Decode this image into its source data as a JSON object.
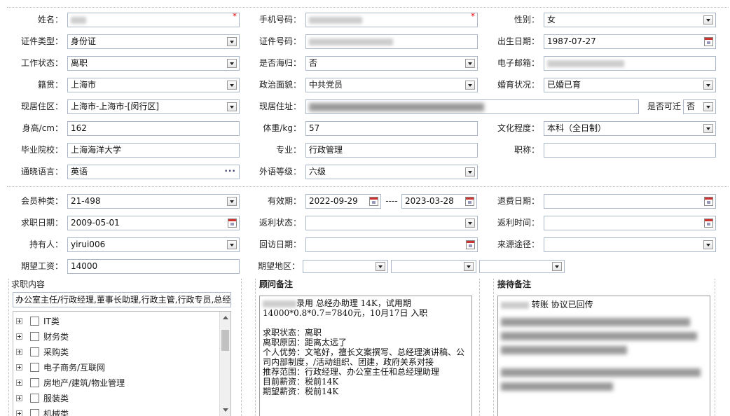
{
  "personal": {
    "name": {
      "label": "姓名：",
      "value": ""
    },
    "phone": {
      "label": "手机号码：",
      "value": ""
    },
    "gender": {
      "label": "性别：",
      "value": "女"
    },
    "id_type": {
      "label": "证件类型：",
      "value": "身份证"
    },
    "id_number": {
      "label": "证件号码：",
      "value": ""
    },
    "birth_date": {
      "label": "出生日期：",
      "value": "1987-07-27"
    },
    "work_status": {
      "label": "工作状态：",
      "value": "离职"
    },
    "returnee": {
      "label": "是否海归：",
      "value": "否"
    },
    "email": {
      "label": "电子邮箱：",
      "value": ""
    },
    "native_place": {
      "label": "籍贯：",
      "value": "上海市"
    },
    "political": {
      "label": "政治面貌：",
      "value": "中共党员"
    },
    "marital": {
      "label": "婚育状况：",
      "value": "已婚已育"
    },
    "current_area": {
      "label": "现居住区：",
      "value": "上海市-上海市-[闵行区]"
    },
    "current_address": {
      "label": "现居住址：",
      "value": ""
    },
    "relocate": {
      "label": "是否可迁",
      "value": "否"
    },
    "height": {
      "label": "身高/cm：",
      "value": "162"
    },
    "weight": {
      "label": "体重/kg：",
      "value": "57"
    },
    "education": {
      "label": "文化程度：",
      "value": "本科（全日制）"
    },
    "school": {
      "label": "毕业院校：",
      "value": "上海海洋大学"
    },
    "major": {
      "label": "专业：",
      "value": "行政管理"
    },
    "title": {
      "label": "职称：",
      "value": ""
    },
    "language": {
      "label": "通晓语言：",
      "value": "英语"
    },
    "language_level": {
      "label": "外语等级：",
      "value": "六级"
    }
  },
  "membership": {
    "member_type": {
      "label": "会员种类：",
      "value": "21-498"
    },
    "validity": {
      "label": "有效期：",
      "start": "2022-09-29",
      "sep": "----",
      "end": "2023-03-28"
    },
    "refund_date": {
      "label": "退费日期：",
      "value": ""
    },
    "job_date": {
      "label": "求职日期：",
      "value": "2009-05-01"
    },
    "rebate_status": {
      "label": "返利状态：",
      "value": ""
    },
    "rebate_time": {
      "label": "返利时间：",
      "value": ""
    },
    "holder": {
      "label": "持有人：",
      "value": "yirui006"
    },
    "visit_date": {
      "label": "回访日期：",
      "value": ""
    },
    "source": {
      "label": "来源途径：",
      "value": ""
    },
    "expected_salary": {
      "label": "期望工资：",
      "value": "14000"
    },
    "expected_area": {
      "label": "期望地区：",
      "v1": "",
      "v2": "",
      "v3": ""
    }
  },
  "job_content": {
    "title": "求职内容",
    "value": "办公室主任/行政经理,董事长助理,行政主管,行政专员,总经",
    "categories": [
      "IT类",
      "财务类",
      "采购类",
      "电子商务/互联网",
      "房地产/建筑/物业管理",
      "服装类",
      "机械类"
    ]
  },
  "advisor_notes": {
    "title": "顾问备注",
    "lines": [
      "录用 总经办助理  14K，试用期",
      "14000*0.8*0.7=7840元，10月17日 入职",
      "",
      "求职状态：离职",
      "离职原因：距离太远了",
      "个人优势：文笔好，擅长文案撰写、总经理演讲稿、公",
      "司内部制度，/活动组织、团建，政府关系对接",
      "推荐范围：行政经理、办公室主任和总经理助理",
      "目前薪资：税前14K",
      "期望薪资：税前14K"
    ]
  },
  "reception_notes": {
    "title": "接待备注",
    "first_line": "转账  协议已回传"
  },
  "colors": {
    "required": "#e00000",
    "border": "#a9b7c9"
  }
}
